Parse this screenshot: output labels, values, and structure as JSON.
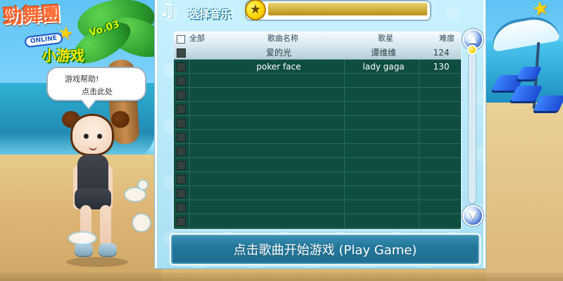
{
  "logo": {
    "main_text": "勁舞團",
    "version_text": "Vo.03",
    "online_text": "ONLINE",
    "subtitle": "小游戏"
  },
  "help_bubble": {
    "line1": "游戏帮助!",
    "line2": "点击此处"
  },
  "panel": {
    "title": "选择音乐",
    "icons": {
      "music": "music-note-icon",
      "star": "star-icon",
      "scroll_up": "scroll-up-icon",
      "scroll_down": "scroll-down-icon"
    },
    "columns": {
      "all": "全部",
      "song": "歌曲名称",
      "artist": "歌星",
      "level": "难度"
    },
    "rows": [
      {
        "song": "爱的光",
        "artist": "谭维维",
        "level": "124",
        "selected": true
      },
      {
        "song": "poker face",
        "artist": "lady gaga",
        "level": "130",
        "selected": false
      }
    ],
    "play_button": "点击歌曲开始游戏 (Play Game)"
  },
  "colors": {
    "panel_bg": "#a8e0f3",
    "table_bg": "#0f4d41",
    "button_bg": "#23779b",
    "selected_row": "#b6cfda"
  }
}
